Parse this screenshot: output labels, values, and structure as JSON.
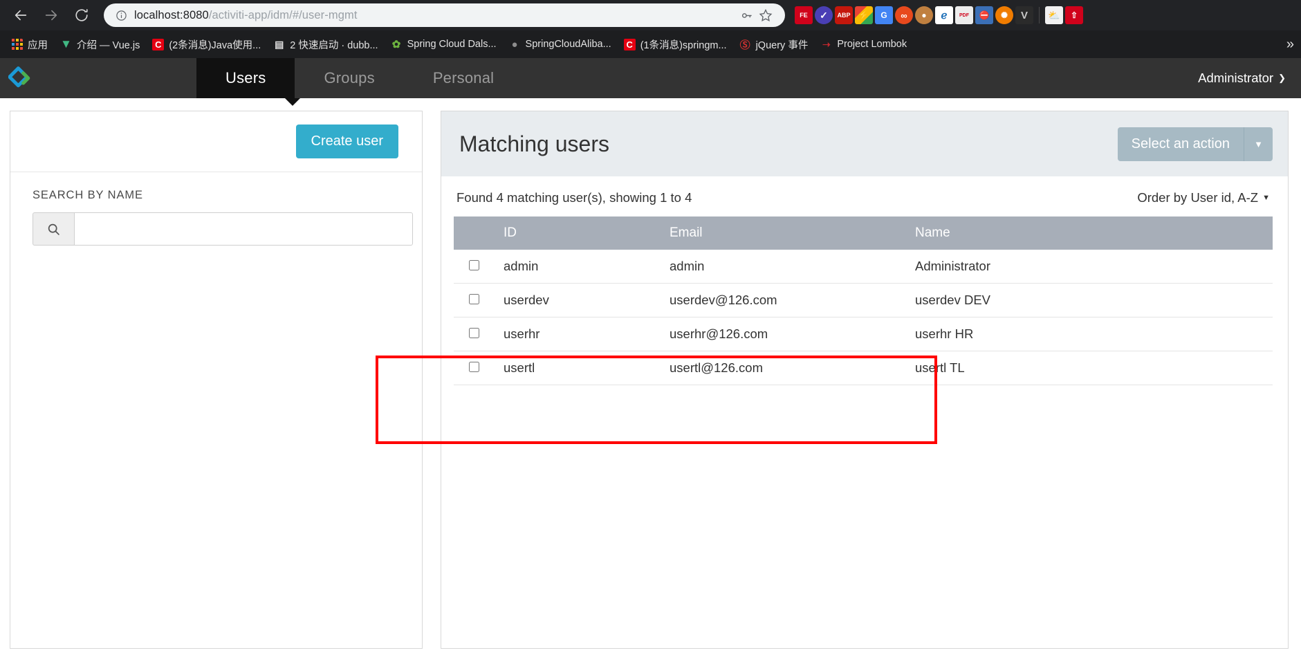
{
  "browser": {
    "nav": {
      "back_icon": "arrow-left-icon",
      "forward_icon": "arrow-right-icon",
      "reload_icon": "reload-icon"
    },
    "omnibox": {
      "info_icon": "info-circle-icon",
      "url_host": "localhost:8080",
      "url_path": "/activiti-app/idm/#/user-mgmt",
      "key_icon": "password-key-icon",
      "star_icon": "bookmark-star-icon"
    },
    "extensions": [
      {
        "name": "fe-helper-extension",
        "label": "FE",
        "bg": "#d0021b",
        "fg": "#ffffff"
      },
      {
        "name": "checkmark-extension",
        "label": "✓",
        "bg": "#4a3fb5",
        "fg": "#ffffff"
      },
      {
        "name": "adblock-plus-extension",
        "label": "ABP",
        "bg": "#c4170c",
        "fg": "#ffffff"
      },
      {
        "name": "lightning-extension",
        "label": "⚡",
        "bg": "#f5c518",
        "fg": "#ffffff"
      },
      {
        "name": "google-translate-extension",
        "label": "G",
        "bg": "#4285f4",
        "fg": "#ffffff"
      },
      {
        "name": "infinity-extension",
        "label": "∞",
        "bg": "#e8491d",
        "fg": "#ffffff"
      },
      {
        "name": "monkey-extension",
        "label": "🐵",
        "bg": "#b4651e",
        "fg": "#ffffff"
      },
      {
        "name": "feather-extension",
        "label": "✐",
        "bg": "#ffffff",
        "fg": "#1d6fb8"
      },
      {
        "name": "pdf-js-extension",
        "label": "PDF",
        "bg": "#ededed",
        "fg": "#d0021b"
      },
      {
        "name": "no-entry-extension",
        "label": "⛔",
        "bg": "#3b6fb6",
        "fg": "#ffffff"
      },
      {
        "name": "lifebuoy-extension",
        "label": "⚽",
        "bg": "#f07c00",
        "fg": "#ffffff"
      },
      {
        "name": "vimium-extension",
        "label": "V",
        "bg": "#2b2b2b",
        "fg": "#c8c8c8"
      }
    ],
    "extensions_right": [
      {
        "name": "weather-extension",
        "label": "⛅",
        "bg": "#f2f2f2",
        "fg": "#f5a623"
      },
      {
        "name": "update-extension",
        "label": "↑",
        "bg": "#d0021b",
        "fg": "#ffffff"
      }
    ],
    "bookmarks": [
      {
        "name": "bookmark-apps",
        "label": "应用",
        "icon": "apps-grid-icon",
        "icon_text": "",
        "bg": "",
        "fg": ""
      },
      {
        "name": "bookmark-vuejs",
        "label": "介绍 — Vue.js",
        "icon": "vue-icon",
        "icon_text": "V",
        "bg": "transparent",
        "fg": "#41b883"
      },
      {
        "name": "bookmark-csdn-java",
        "label": "(2条消息)Java使用...",
        "icon": "csdn-icon",
        "icon_text": "C",
        "bg": "#e60012",
        "fg": "#ffffff"
      },
      {
        "name": "bookmark-dubbo",
        "label": "2 快速启动 · dubb...",
        "icon": "dubbo-icon",
        "icon_text": "⚌",
        "bg": "transparent",
        "fg": "#e6e6e6"
      },
      {
        "name": "bookmark-spring-cloud-dalston",
        "label": "Spring Cloud Dals...",
        "icon": "spring-leaf-icon",
        "icon_text": "✿",
        "bg": "transparent",
        "fg": "#6db33f"
      },
      {
        "name": "bookmark-springcloudalibaba",
        "label": "SpringCloudAliba...",
        "icon": "github-icon",
        "icon_text": "●",
        "bg": "transparent",
        "fg": "#8d8d8d"
      },
      {
        "name": "bookmark-csdn-springm",
        "label": "(1条消息)springm...",
        "icon": "csdn-icon",
        "icon_text": "C",
        "bg": "#e60012",
        "fg": "#ffffff"
      },
      {
        "name": "bookmark-jquery-events",
        "label": "jQuery 事件",
        "icon": "jquery-icon",
        "icon_text": "Ⓢ",
        "bg": "transparent",
        "fg": "#cf3030"
      },
      {
        "name": "bookmark-project-lombok",
        "label": "Project Lombok",
        "icon": "lombok-chili-icon",
        "icon_text": "🌶",
        "bg": "transparent",
        "fg": "#c1272d"
      }
    ],
    "bookmarks_overflow_icon": "chevron-double-right-icon"
  },
  "app": {
    "logo_name": "activiti-logo",
    "tabs": [
      {
        "id": "users",
        "label": "Users",
        "active": true
      },
      {
        "id": "groups",
        "label": "Groups",
        "active": false
      },
      {
        "id": "personal",
        "label": "Personal",
        "active": false
      }
    ],
    "user_menu": {
      "label": "Administrator",
      "caret_icon": "chevron-down-icon"
    }
  },
  "left_panel": {
    "create_button_label": "Create user",
    "search_label": "SEARCH BY NAME",
    "search_icon": "search-icon",
    "search_value": "",
    "search_placeholder": ""
  },
  "right_panel": {
    "title": "Matching users",
    "action_button_label": "Select an action",
    "action_caret_icon": "caret-down-icon",
    "found_text": "Found 4 matching user(s), showing 1 to 4",
    "order_by_label": "Order by User id, A-Z",
    "order_by_caret_icon": "caret-down-icon",
    "table": {
      "columns": [
        "",
        "ID",
        "Email",
        "Name"
      ],
      "rows": [
        {
          "checked": false,
          "id": "admin",
          "email": "admin",
          "name": "Administrator"
        },
        {
          "checked": false,
          "id": "userdev",
          "email": "userdev@126.com",
          "name": "userdev DEV"
        },
        {
          "checked": false,
          "id": "userhr",
          "email": "userhr@126.com",
          "name": "userhr HR"
        },
        {
          "checked": false,
          "id": "usertl",
          "email": "usertl@126.com",
          "name": "usertl TL"
        }
      ]
    }
  },
  "annotation": {
    "name": "red-highlight-box",
    "color": "#ff0000"
  },
  "colors": {
    "accent_blue": "#33adcc",
    "action_gray": "#a7bac4",
    "table_header": "#a7aeb8",
    "panel_header": "#e8ecef",
    "nav_dark": "#333333",
    "tab_active": "#111111"
  }
}
